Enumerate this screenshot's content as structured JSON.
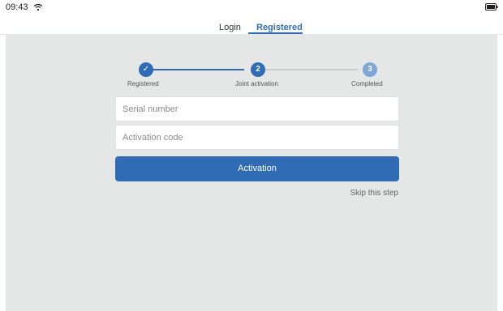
{
  "status_bar": {
    "time": "09:43"
  },
  "tabs": {
    "login": "Login",
    "registered": "Registered"
  },
  "stepper": {
    "steps": [
      {
        "label": "Registered",
        "number": "✓"
      },
      {
        "label": "Joint activation",
        "number": "2"
      },
      {
        "label": "Completed",
        "number": "3"
      }
    ]
  },
  "form": {
    "serial_placeholder": "Serial number",
    "code_placeholder": "Activation code",
    "activation_button": "Activation",
    "skip_link": "Skip this step"
  },
  "colors": {
    "accent": "#2f6cb5",
    "content_bg": "#e5e6e6"
  }
}
